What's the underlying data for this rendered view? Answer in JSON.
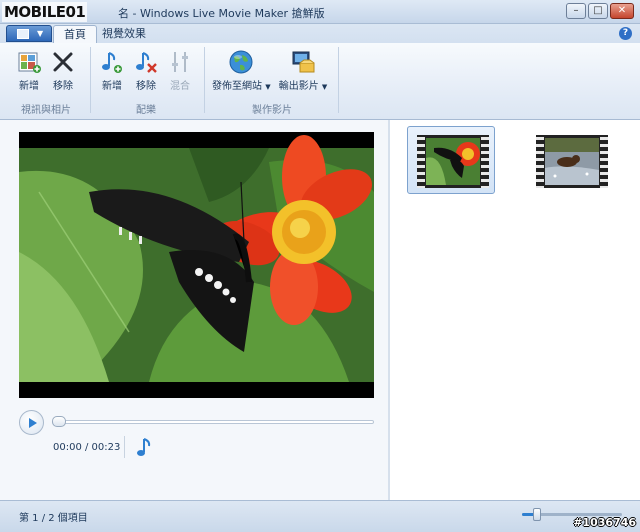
{
  "watermark": {
    "logo_text": "MOBILE01",
    "id_text": "#1036746"
  },
  "window": {
    "title": "名 - Windows Live Movie Maker 搶鮮版",
    "minimize": "–",
    "maximize": "□",
    "close": "✕"
  },
  "tabs": [
    {
      "label": "首頁",
      "active": true
    },
    {
      "label": "視覺效果",
      "active": false
    }
  ],
  "help": "?",
  "ribbon": {
    "groups": [
      {
        "label": "視訊與相片",
        "buttons": [
          {
            "label": "新增",
            "icon": "add-photos-icon"
          },
          {
            "label": "移除",
            "icon": "remove-x-icon"
          }
        ]
      },
      {
        "label": "配樂",
        "buttons": [
          {
            "label": "新增",
            "icon": "add-music-icon"
          },
          {
            "label": "移除",
            "icon": "remove-music-icon"
          },
          {
            "label": "混合",
            "icon": "mix-sliders-icon",
            "disabled": true
          }
        ]
      },
      {
        "label": "製作影片",
        "buttons": [
          {
            "label": "發佈至網站",
            "icon": "globe-icon"
          },
          {
            "label": "輸出影片",
            "icon": "output-movie-icon"
          }
        ]
      }
    ]
  },
  "player": {
    "time": "00:00 / 00:23",
    "progress": 0
  },
  "storyboard": {
    "items": [
      {
        "selected": true,
        "subject": "butterfly-flower"
      },
      {
        "selected": false,
        "subject": "animal-water"
      }
    ]
  },
  "status": {
    "text": "第 1 / 2 個項目",
    "zoom_level": 0.15
  },
  "colors": {
    "accent": "#2e7fd0",
    "flower": "#e8381a",
    "leaf": "#5f9b3a"
  }
}
